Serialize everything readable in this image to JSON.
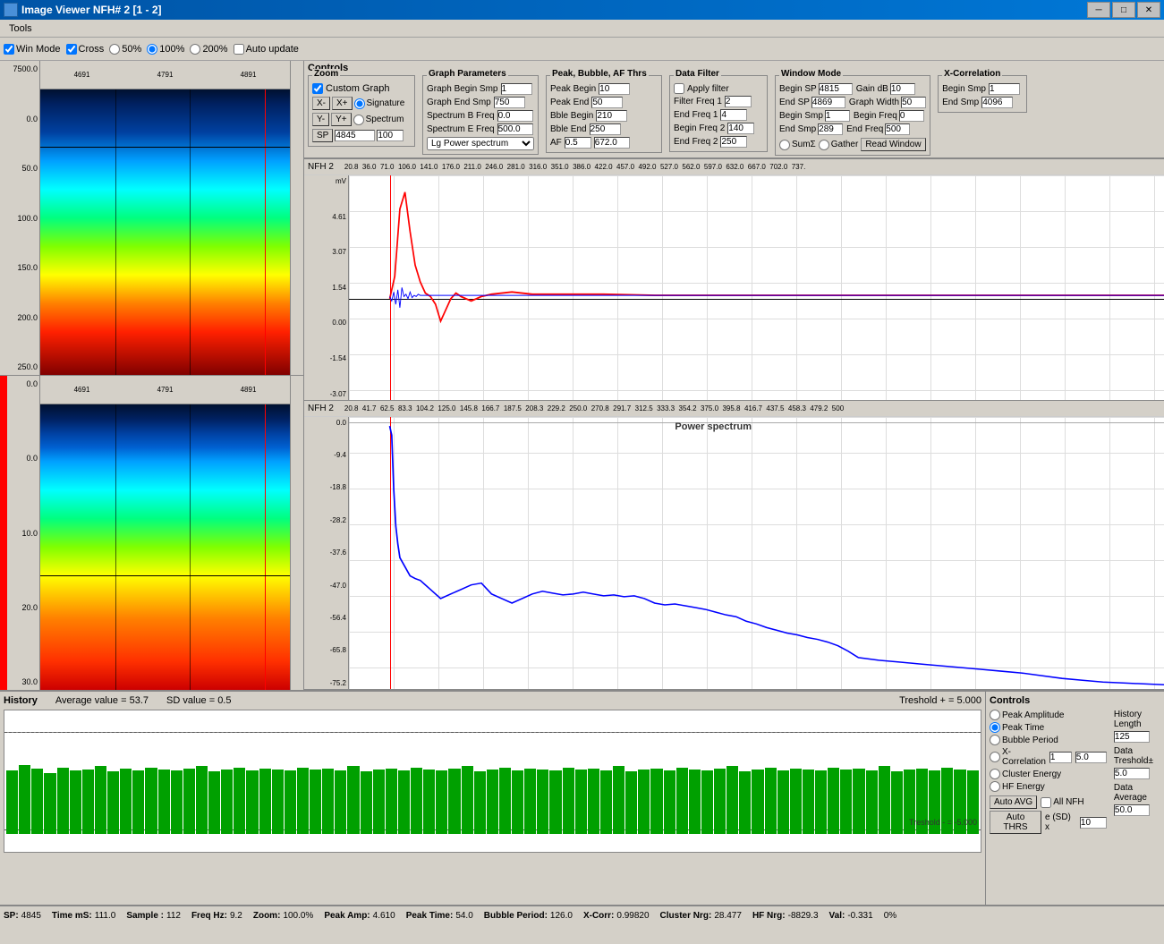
{
  "titleBar": {
    "title": "Image Viewer NFH# 2 [1 - 2]",
    "minimize": "─",
    "maximize": "□",
    "close": "✕"
  },
  "menuBar": {
    "items": [
      "Tools"
    ]
  },
  "toolbar": {
    "winMode": "Win Mode",
    "cross": "Cross",
    "zoom50": "50%",
    "zoom100": "100%",
    "zoom200": "200%",
    "autoUpdate": "Auto update"
  },
  "controls": {
    "title": "Controls",
    "zoom": {
      "label": "Zoom",
      "customGraph": "Custom Graph",
      "xMinus": "X-",
      "xPlus": "X+",
      "signature": "Signature",
      "yMinus": "Y-",
      "yPlus": "Y+",
      "spectrum": "Spectrum",
      "sp": "SP",
      "spValue": "4845",
      "zoomValue": "100"
    },
    "graphParams": {
      "label": "Graph Parameters",
      "graphBeginSmp": "Graph Begin Smp",
      "graphBeginVal": "1",
      "graphEndSmp": "Graph End Smp",
      "graphEndVal": "750",
      "spectrumBFreq": "Spectrum B Freq",
      "spectrumBVal": "0.0",
      "spectrumEFreq": "Spectrum E Freq",
      "spectrumEVal": "500.0",
      "dropdown": "Lg Power spectrum"
    },
    "peakBubble": {
      "label": "Peak, Bubble, AF Thrs",
      "peakBegin": "Peak Begin",
      "peakBeginVal": "10",
      "peakEnd": "Peak End",
      "peakEndVal": "50",
      "bbleBegin": "Bble Begin",
      "bbleBeginVal": "210",
      "bbleEnd": "Bble End",
      "bbleEndVal": "250",
      "af": "AF",
      "afVal": "0.5",
      "af2Val": "672.0"
    },
    "dataFilter": {
      "label": "Data Filter",
      "applyFilter": "Apply filter",
      "freqBegin1": "Filter Freq 1",
      "freqBegin1Val": "2",
      "endFreq1": "End Freq 1",
      "endFreq1Val": "4",
      "freqBegin2": "Begin Freq 2",
      "freqBegin2Val": "140",
      "endFreq2": "End Freq 2",
      "endFreq2Val": "250"
    },
    "windowMode": {
      "label": "Window Mode",
      "beginSP": "Begin SP",
      "beginSPVal": "4815",
      "endSP": "End SP",
      "endSPVal": "4869",
      "beginSmp": "Begin Smp",
      "beginSmpVal": "1",
      "endSmp": "End Smp",
      "endSmpVal": "289",
      "gainDB": "Gain dB",
      "gainDBVal": "10",
      "graphWidth": "Graph Width",
      "graphWidthVal": "50",
      "beginFreq": "Begin Freq",
      "beginFreqVal": "0",
      "endFreq": "End Freq",
      "endFreqVal": "500",
      "sumI": "SumΣ",
      "gather": "Gather",
      "readWindow": "Read Window"
    },
    "xCorrelation": {
      "label": "X-Correlation",
      "beginSmp": "Begin Smp",
      "beginSmpVal": "1",
      "endSmp": "End Smp",
      "endSmpVal": "4096"
    }
  },
  "topGraph": {
    "label": "NFH 2",
    "unit": "mV",
    "xLabels": [
      "36.0",
      "71.0",
      "106.0",
      "141.0",
      "176.0",
      "211.0",
      "246.0",
      "281.0",
      "316.0",
      "351.0",
      "386.0",
      "422.0",
      "457.0",
      "492.0",
      "527.0",
      "562.0",
      "597.0",
      "632.0",
      "667.0",
      "702.0",
      "737."
    ],
    "yLabels": [
      "4.61",
      "3.07",
      "1.54",
      "0.00",
      "-1.54",
      "-3.07"
    ]
  },
  "bottomGraph": {
    "label": "NFH 2",
    "xLabels": [
      "20.8",
      "41.7",
      "62.5",
      "83.3",
      "104.2",
      "125.0",
      "145.8",
      "166.7",
      "187.5",
      "208.3",
      "229.2",
      "250.0",
      "270.8",
      "291.7",
      "312.5",
      "333.3",
      "354.2",
      "375.0",
      "395.8",
      "416.7",
      "437.5",
      "458.3",
      "479.2",
      "500"
    ],
    "yLabels": [
      "0.0",
      "-9.4",
      "-18.8",
      "-28.2",
      "-37.6",
      "-47.0",
      "-56.4",
      "-65.8",
      "-75.2"
    ],
    "title": "Power spectrum"
  },
  "leftPanelTop": {
    "xLabels": [
      "4691",
      "4791",
      "4891"
    ],
    "yLabels": [
      "7500.0",
      "",
      "0.0",
      "",
      "50.0",
      "",
      "100.0",
      "",
      "150.0",
      "",
      "200.0",
      "",
      "250.0"
    ]
  },
  "leftPanelBottom": {
    "xLabels": [
      "4691",
      "4791",
      "4891"
    ],
    "yLabels": [
      "0.0",
      "",
      "0.0",
      "",
      "10.0",
      "",
      "20.0",
      "",
      "30.0"
    ]
  },
  "history": {
    "title": "History",
    "averageLabel": "Average value =",
    "averageVal": "53.7",
    "sdLabel": "SD value =",
    "sdVal": "0.5",
    "thresholdPlus": "Treshold + = 5.000",
    "thresholdMinus": "Treshold - = -5.000",
    "controls": {
      "title": "Controls",
      "peakAmplitude": "Peak Amplitude",
      "peakTime": "Peak Time",
      "bubblePeriod": "Bubble Period",
      "xCorrelation": "X-Correlation",
      "clusterEnergy": "Cluster Energy",
      "hfEnergy": "HF Energy",
      "historyLength": "History Length",
      "historyLengthVal": "125",
      "dataTreshold": "Data Treshold±",
      "dataTresholdVal": "5.0",
      "xCorrVal": "1",
      "dataAverage": "Data Average",
      "dataAverageVal": "50.0",
      "autoAVG": "Auto AVG",
      "allNFH": "All NFH",
      "autoTHRS": "Auto THRS",
      "eSdX": "e (SD) x",
      "eSdXVal": "10"
    }
  },
  "statusBar": {
    "sp": "SP:",
    "spVal": "4845",
    "timeMs": "Time mS:",
    "timeMsVal": "111.0",
    "sample": "Sample :",
    "sampleVal": "112",
    "freqHz": "Freq Hz:",
    "freqHzVal": "9.2",
    "zoom": "Zoom:",
    "zoomVal": "100.0%",
    "peakAmp": "Peak Amp:",
    "peakAmpVal": "4.610",
    "peakTime": "Peak Time:",
    "peakTimeVal": "54.0",
    "bubblePeriod": "Bubble Period:",
    "bubblePeriodVal": "126.0",
    "xCorr": "X-Corr:",
    "xCorrVal": "0.99820",
    "clusterNrg": "Cluster Nrg:",
    "clusterNrgVal": "28.477",
    "hfNrg": "HF Nrg:",
    "hfNrgVal": "-8829.3",
    "val": "Val:",
    "valVal": "-0.331",
    "percent": "0%"
  }
}
